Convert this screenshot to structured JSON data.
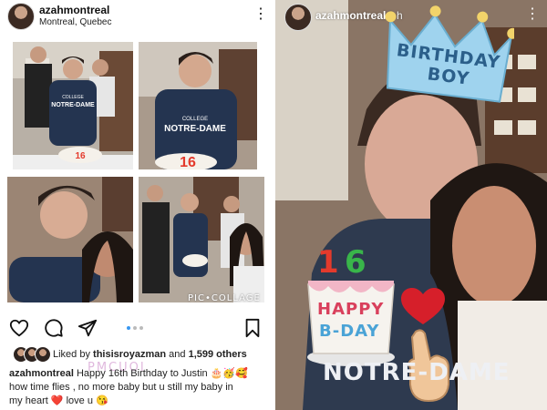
{
  "post": {
    "username": "azahmontreal",
    "location": "Montreal, Quebec",
    "collage_watermark": "PIC•COLLAGE",
    "photo_texts": {
      "hoodie_line1": "COLLEGE",
      "hoodie_line2": "NOTRE-DAME",
      "cake_number": "16"
    },
    "actions": {
      "like": "heart-icon",
      "comment": "comment-icon",
      "share": "paper-plane-icon",
      "save": "bookmark-icon"
    },
    "carousel_dots": 3,
    "carousel_active": 0,
    "likes": {
      "prefix": "Liked by ",
      "user": "thisisroyazman",
      "middle": " and ",
      "count": "1,599 others"
    },
    "caption": {
      "username": "azahmontreal",
      "text_line1": " Happy 16th Birthday to Justin 🎂🥳🥰",
      "text_line2": "how time flies , no more baby but u still my baby in",
      "text_line3": "my heart ❤️ love u 😘",
      "watermark": "PMCUOI"
    }
  },
  "story": {
    "username": "azahmontreal",
    "time": "3 h",
    "crown_line1": "BIRTHDAY",
    "crown_line2": "BOY",
    "cake_number_1": "1",
    "cake_number_6": "6",
    "cake_line1": "HAPPY",
    "cake_line2": "B-DAY",
    "hoodie_text": "NOTRE-DAME",
    "colors": {
      "crown": "#9fd3ee",
      "heart": "#d61f2a",
      "candle_red": "#e43a2c",
      "candle_green": "#39b54a"
    }
  }
}
